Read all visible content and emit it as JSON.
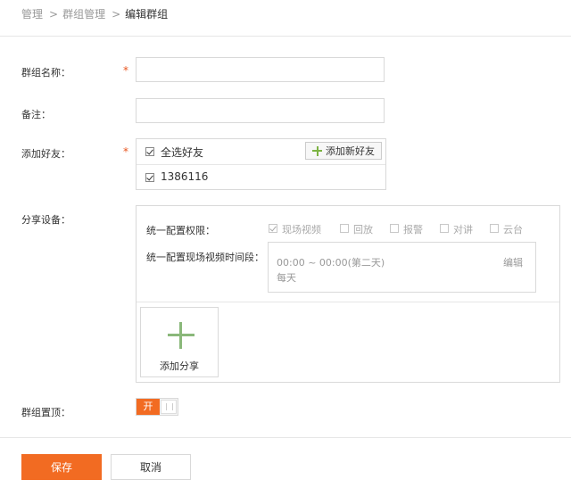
{
  "breadcrumb": {
    "items": [
      "管理",
      "群组管理"
    ],
    "separator": ">",
    "current": "编辑群组"
  },
  "form": {
    "name_label": "群组名称：",
    "required_mark": "*",
    "name_value": "",
    "remark_label": "备注：",
    "remark_value": "",
    "friends_label": "添加好友：",
    "select_all_label": "全选好友",
    "select_all_checked": true,
    "add_friend_button": "添加新好友",
    "friends": [
      {
        "label": "1386116",
        "checked": true
      }
    ],
    "share_label": "分享设备：",
    "pin_label": "群组置顶："
  },
  "share": {
    "permission_label": "统一配置权限：",
    "permissions": [
      {
        "label": "现场视频",
        "checked": true
      },
      {
        "label": "回放",
        "checked": false
      },
      {
        "label": "报警",
        "checked": false
      },
      {
        "label": "对讲",
        "checked": false
      },
      {
        "label": "云台",
        "checked": false
      }
    ],
    "time_label": "统一配置现场视频时间段：",
    "time_range": "00:00 ~ 00:00(第二天)",
    "time_repeat": "每天",
    "edit_label": "编辑",
    "add_share_label": "添加分享"
  },
  "pin_toggle": {
    "on_label": "开",
    "state": "on"
  },
  "actions": {
    "save": "保存",
    "cancel": "取消"
  },
  "colors": {
    "accent": "#f26b22",
    "plus_green": "#7cb342",
    "required": "#e8541e"
  },
  "icons": {
    "add": "plus-icon",
    "checkbox": "checkbox-icon"
  }
}
